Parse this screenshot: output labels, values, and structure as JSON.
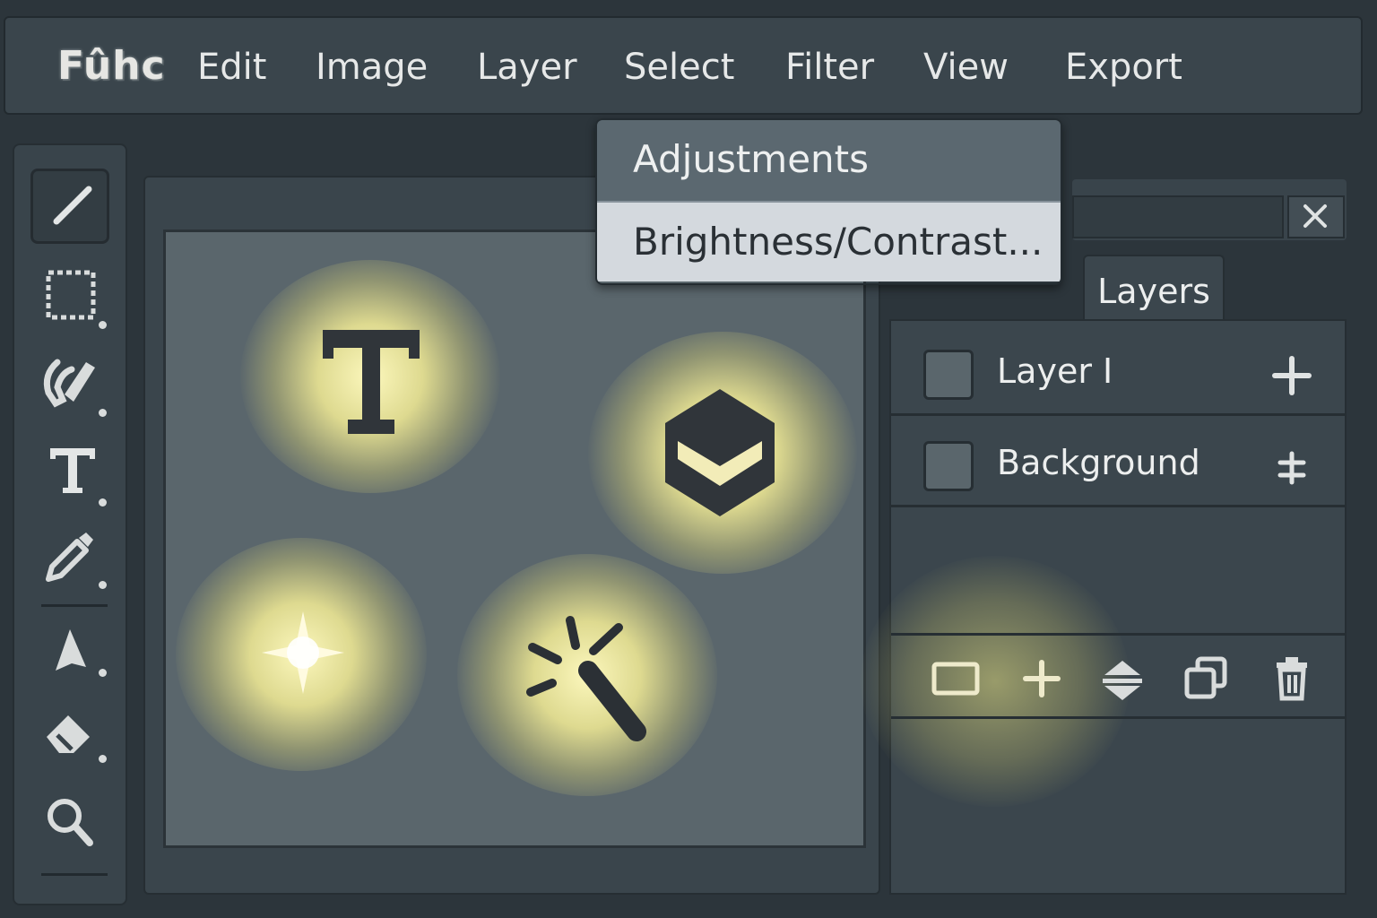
{
  "app": {
    "logo_text": "Fûhc"
  },
  "menubar": {
    "items": [
      {
        "label": "Edit"
      },
      {
        "label": "Image"
      },
      {
        "label": "Layer"
      },
      {
        "label": "Select"
      },
      {
        "label": "Filter"
      },
      {
        "label": "View"
      },
      {
        "label": "Export"
      }
    ]
  },
  "dropdown": {
    "items": [
      {
        "label": "Adjustments"
      },
      {
        "label": "Brightness/Contrast..."
      }
    ]
  },
  "toolbox": {
    "tools": [
      {
        "icon": "brush-icon"
      },
      {
        "icon": "marquee-select-icon"
      },
      {
        "icon": "lasso-icon"
      },
      {
        "icon": "text-tool-icon"
      },
      {
        "icon": "eyedropper-icon"
      },
      {
        "icon": "pen-tool-icon"
      },
      {
        "icon": "eraser-icon"
      },
      {
        "icon": "zoom-icon"
      }
    ],
    "selected_tool": "brush-icon"
  },
  "canvas": {
    "glowing_icons": [
      "text-icon",
      "layers-stack-icon",
      "sparkle-icon",
      "magic-wand-icon"
    ],
    "glow_color": "#f5eea0"
  },
  "right_panel": {
    "close_label": "✕",
    "tab_label": "Layers"
  },
  "layers": {
    "items": [
      {
        "name": "Layer I",
        "action_icon": "add-icon"
      },
      {
        "name": "Background",
        "action_icon": "adjust-icon"
      }
    ],
    "footer_buttons": [
      "new-layer-icon",
      "add-icon",
      "merge-icon",
      "duplicate-icon",
      "trash-icon"
    ]
  },
  "colors": {
    "background": "#2c353b",
    "panel": "#3a454c",
    "canvas": "#5a666c",
    "text": "#e6e8e8",
    "dropdown_highlight": "#d4d9de"
  }
}
